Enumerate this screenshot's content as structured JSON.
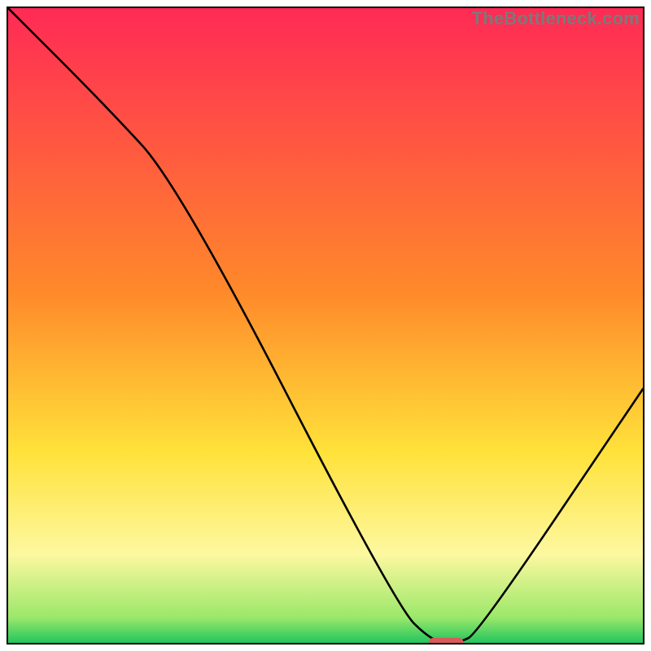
{
  "watermark": "TheBottleneck.com",
  "chart_data": {
    "type": "line",
    "title": "",
    "xlabel": "",
    "ylabel": "",
    "xlim": [
      0,
      100
    ],
    "ylim": [
      0,
      100
    ],
    "grid": false,
    "legend": false,
    "background_gradient": {
      "stops": [
        {
          "offset": 0.0,
          "color": "#ff2a55"
        },
        {
          "offset": 0.45,
          "color": "#ff8a2a"
        },
        {
          "offset": 0.7,
          "color": "#ffe23a"
        },
        {
          "offset": 0.86,
          "color": "#fdf8a0"
        },
        {
          "offset": 0.96,
          "color": "#9be86a"
        },
        {
          "offset": 1.0,
          "color": "#22c55e"
        }
      ]
    },
    "series": [
      {
        "name": "bottleneck-curve",
        "x": [
          0,
          15,
          27,
          61,
          67,
          71,
          74,
          100
        ],
        "y": [
          100,
          85,
          72,
          6,
          0,
          0,
          1.5,
          40
        ]
      }
    ],
    "marker": {
      "name": "optimum-point",
      "x": 69,
      "y": 0,
      "width_pct": 5.5,
      "height_pct": 1.6,
      "color": "#d85a5a",
      "rx": 6
    }
  }
}
